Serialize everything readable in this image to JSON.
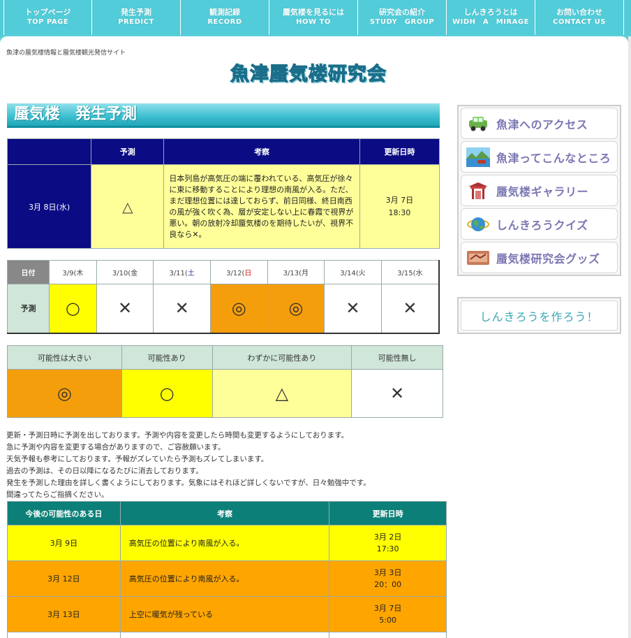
{
  "nav": [
    {
      "jp": "トップページ",
      "en": "TOP PAGE"
    },
    {
      "jp": "発生予測",
      "en": "PREDICT"
    },
    {
      "jp": "観測記録",
      "en": "RECORD"
    },
    {
      "jp": "蜃気楼を見るには",
      "en": "HOW TO"
    },
    {
      "jp": "研究会の紹介",
      "en": "STUDY　GROUP"
    },
    {
      "jp": "しんきろうとは",
      "en": "WIDH　A　MIRAGE"
    },
    {
      "jp": "お問い合わせ",
      "en": "CONTACT US"
    }
  ],
  "header": {
    "tagline": "魚津の蜃気楼情報と蜃気楼観光発信サイト",
    "logo_text": "魚津蜃気楼研究会"
  },
  "section_title": "蜃気楼　発生予測",
  "main_forecast": {
    "headers": [
      "",
      "予測",
      "考察",
      "更新日時"
    ],
    "date": "3月 8日(水)",
    "mark": "△",
    "text": "日本列島が高気圧の端に覆われている、高気圧が徐々に東に移動することにより理想の南風が入る。ただ、まだ理想位置には達しておらず、前日同様、終日南西の風が強く吹く為、層が安定しない上に春霞で視界が悪い。朝の放射冷却蜃気楼のを期待したいが、視界不良なら✕。",
    "updated_date": "3月 7日",
    "updated_time": "18:30"
  },
  "weekly": {
    "label_date": "日付",
    "label_pred": "予測",
    "days": [
      {
        "pre": "3/9(",
        "dow": "木",
        "cls": "",
        "mark": "○",
        "bg": "bg-yellow"
      },
      {
        "pre": "3/10(",
        "dow": "金",
        "cls": "",
        "mark": "✕",
        "bg": "bg-white"
      },
      {
        "pre": "3/11(",
        "dow": "土",
        "cls": "sat",
        "mark": "✕",
        "bg": "bg-white"
      },
      {
        "pre": "3/12(",
        "dow": "日",
        "cls": "sun",
        "mark": "◎",
        "bg": "bg-orange"
      },
      {
        "pre": "3/13(",
        "dow": "月",
        "cls": "",
        "mark": "◎",
        "bg": "bg-orange"
      },
      {
        "pre": "3/14(",
        "dow": "火",
        "cls": "",
        "mark": "✕",
        "bg": "bg-white"
      },
      {
        "pre": "3/15(",
        "dow": "水",
        "cls": "",
        "mark": "✕",
        "bg": "bg-white"
      }
    ]
  },
  "legend": [
    {
      "label": "可能性は大きい",
      "mark": "◎",
      "bg": "bg-orange"
    },
    {
      "label": "可能性あり",
      "mark": "○",
      "bg": "bg-yellow"
    },
    {
      "label": "わずかに可能性あり",
      "mark": "△",
      "bg": "bg-lyellow"
    },
    {
      "label": "可能性無し",
      "mark": "✕",
      "bg": "bg-white"
    }
  ],
  "notes": [
    "更新・予測日時に予測を出しております。予測や内容を変更したら時間も変更するようにしております。",
    "急に予測や内容を変更する場合がありますので、ご容赦願います。",
    "天気予報も参考にしております。予報がズレていたら予測もズレてしまいます。",
    "過去の予測は、その日以降になるたびに消去しております。",
    "発生を予測した理由を詳しく書くようにしております。気象にはそれほど詳しくないですが、日々勉強中です。",
    "間違ってたらご指摘ください。"
  ],
  "future": {
    "headers": [
      "今後の可能性のある日",
      "考察",
      "更新日時"
    ],
    "rows": [
      {
        "date": "3月 9日",
        "text": "高気圧の位置により南風が入る。",
        "upd_date": "3月 2日",
        "upd_time": "17:30",
        "bg": "bg-yellow"
      },
      {
        "date": "3月 12日",
        "text": "高気圧の位置により南風が入る。",
        "upd_date": "3月 3日",
        "upd_time": "20：00",
        "bg": "bg-orange2"
      },
      {
        "date": "3月 13日",
        "text": "上空に暖気が残っている",
        "upd_date": "3月 7日",
        "upd_time": "5:00",
        "bg": "bg-orange2"
      }
    ]
  },
  "sidebar": [
    {
      "label": "魚津へのアクセス",
      "icon": "car-icon"
    },
    {
      "label": "魚津ってこんなところ",
      "icon": "scenery-icon"
    },
    {
      "label": "蜃気楼ギャラリー",
      "icon": "gate-icon"
    },
    {
      "label": "しんきろうクイズ",
      "icon": "globe-icon"
    },
    {
      "label": "蜃気楼研究会グッズ",
      "icon": "goods-icon"
    }
  ],
  "make_button": "しんきろうを作ろう！"
}
